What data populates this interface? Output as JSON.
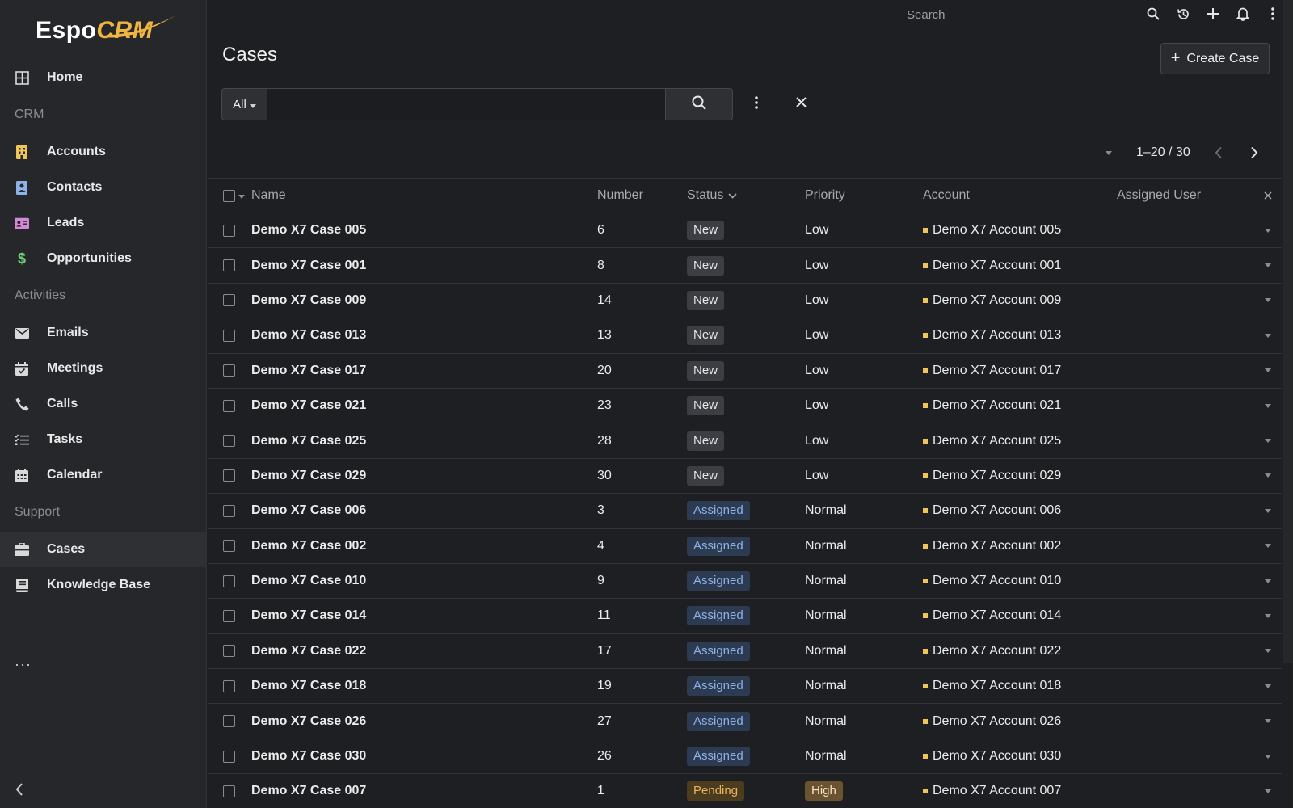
{
  "app": {
    "logo_main": "Espo",
    "logo_accent": "CRM",
    "colors": {
      "accent": "#f0b541",
      "background": "#1e1f22",
      "sidebar": "#26272b"
    }
  },
  "sidebar": {
    "home": {
      "label": "Home",
      "icon": "grid-icon"
    },
    "sections": [
      {
        "title": "CRM"
      },
      {
        "title": "Activities"
      },
      {
        "title": "Support"
      }
    ],
    "crm_items": [
      {
        "label": "Accounts",
        "icon": "building-icon",
        "color": "#f0c65a"
      },
      {
        "label": "Contacts",
        "icon": "contact-card-icon",
        "color": "#8fb2e6"
      },
      {
        "label": "Leads",
        "icon": "id-card-icon",
        "color": "#d38ad6"
      },
      {
        "label": "Opportunities",
        "icon": "dollar-icon",
        "color": "#6fcf7a"
      }
    ],
    "activity_items": [
      {
        "label": "Emails",
        "icon": "envelope-icon"
      },
      {
        "label": "Meetings",
        "icon": "calendar-check-icon"
      },
      {
        "label": "Calls",
        "icon": "phone-icon"
      },
      {
        "label": "Tasks",
        "icon": "checklist-icon"
      },
      {
        "label": "Calendar",
        "icon": "calendar-icon"
      }
    ],
    "support_items": [
      {
        "label": "Cases",
        "icon": "briefcase-icon",
        "active": true
      },
      {
        "label": "Knowledge Base",
        "icon": "book-icon"
      }
    ],
    "more_label": "···"
  },
  "topbar": {
    "search_placeholder": "Search"
  },
  "page": {
    "title": "Cases",
    "create_label": "Create Case"
  },
  "filter": {
    "selected": "All",
    "search_value": ""
  },
  "pagination": {
    "text": "1–20 / 30"
  },
  "table": {
    "columns": {
      "name": "Name",
      "number": "Number",
      "status": "Status",
      "priority": "Priority",
      "account": "Account",
      "assigned_user": "Assigned User"
    },
    "rows": [
      {
        "name": "Demo X7 Case 005",
        "number": "6",
        "status": "New",
        "priority": "Low",
        "account": "Demo X7 Account 005"
      },
      {
        "name": "Demo X7 Case 001",
        "number": "8",
        "status": "New",
        "priority": "Low",
        "account": "Demo X7 Account 001"
      },
      {
        "name": "Demo X7 Case 009",
        "number": "14",
        "status": "New",
        "priority": "Low",
        "account": "Demo X7 Account 009"
      },
      {
        "name": "Demo X7 Case 013",
        "number": "13",
        "status": "New",
        "priority": "Low",
        "account": "Demo X7 Account 013"
      },
      {
        "name": "Demo X7 Case 017",
        "number": "20",
        "status": "New",
        "priority": "Low",
        "account": "Demo X7 Account 017"
      },
      {
        "name": "Demo X7 Case 021",
        "number": "23",
        "status": "New",
        "priority": "Low",
        "account": "Demo X7 Account 021"
      },
      {
        "name": "Demo X7 Case 025",
        "number": "28",
        "status": "New",
        "priority": "Low",
        "account": "Demo X7 Account 025"
      },
      {
        "name": "Demo X7 Case 029",
        "number": "30",
        "status": "New",
        "priority": "Low",
        "account": "Demo X7 Account 029"
      },
      {
        "name": "Demo X7 Case 006",
        "number": "3",
        "status": "Assigned",
        "priority": "Normal",
        "account": "Demo X7 Account 006"
      },
      {
        "name": "Demo X7 Case 002",
        "number": "4",
        "status": "Assigned",
        "priority": "Normal",
        "account": "Demo X7 Account 002"
      },
      {
        "name": "Demo X7 Case 010",
        "number": "9",
        "status": "Assigned",
        "priority": "Normal",
        "account": "Demo X7 Account 010"
      },
      {
        "name": "Demo X7 Case 014",
        "number": "11",
        "status": "Assigned",
        "priority": "Normal",
        "account": "Demo X7 Account 014"
      },
      {
        "name": "Demo X7 Case 022",
        "number": "17",
        "status": "Assigned",
        "priority": "Normal",
        "account": "Demo X7 Account 022"
      },
      {
        "name": "Demo X7 Case 018",
        "number": "19",
        "status": "Assigned",
        "priority": "Normal",
        "account": "Demo X7 Account 018"
      },
      {
        "name": "Demo X7 Case 026",
        "number": "27",
        "status": "Assigned",
        "priority": "Normal",
        "account": "Demo X7 Account 026"
      },
      {
        "name": "Demo X7 Case 030",
        "number": "26",
        "status": "Assigned",
        "priority": "Normal",
        "account": "Demo X7 Account 030"
      },
      {
        "name": "Demo X7 Case 007",
        "number": "1",
        "status": "Pending",
        "priority": "High",
        "account": "Demo X7 Account 007"
      }
    ]
  }
}
